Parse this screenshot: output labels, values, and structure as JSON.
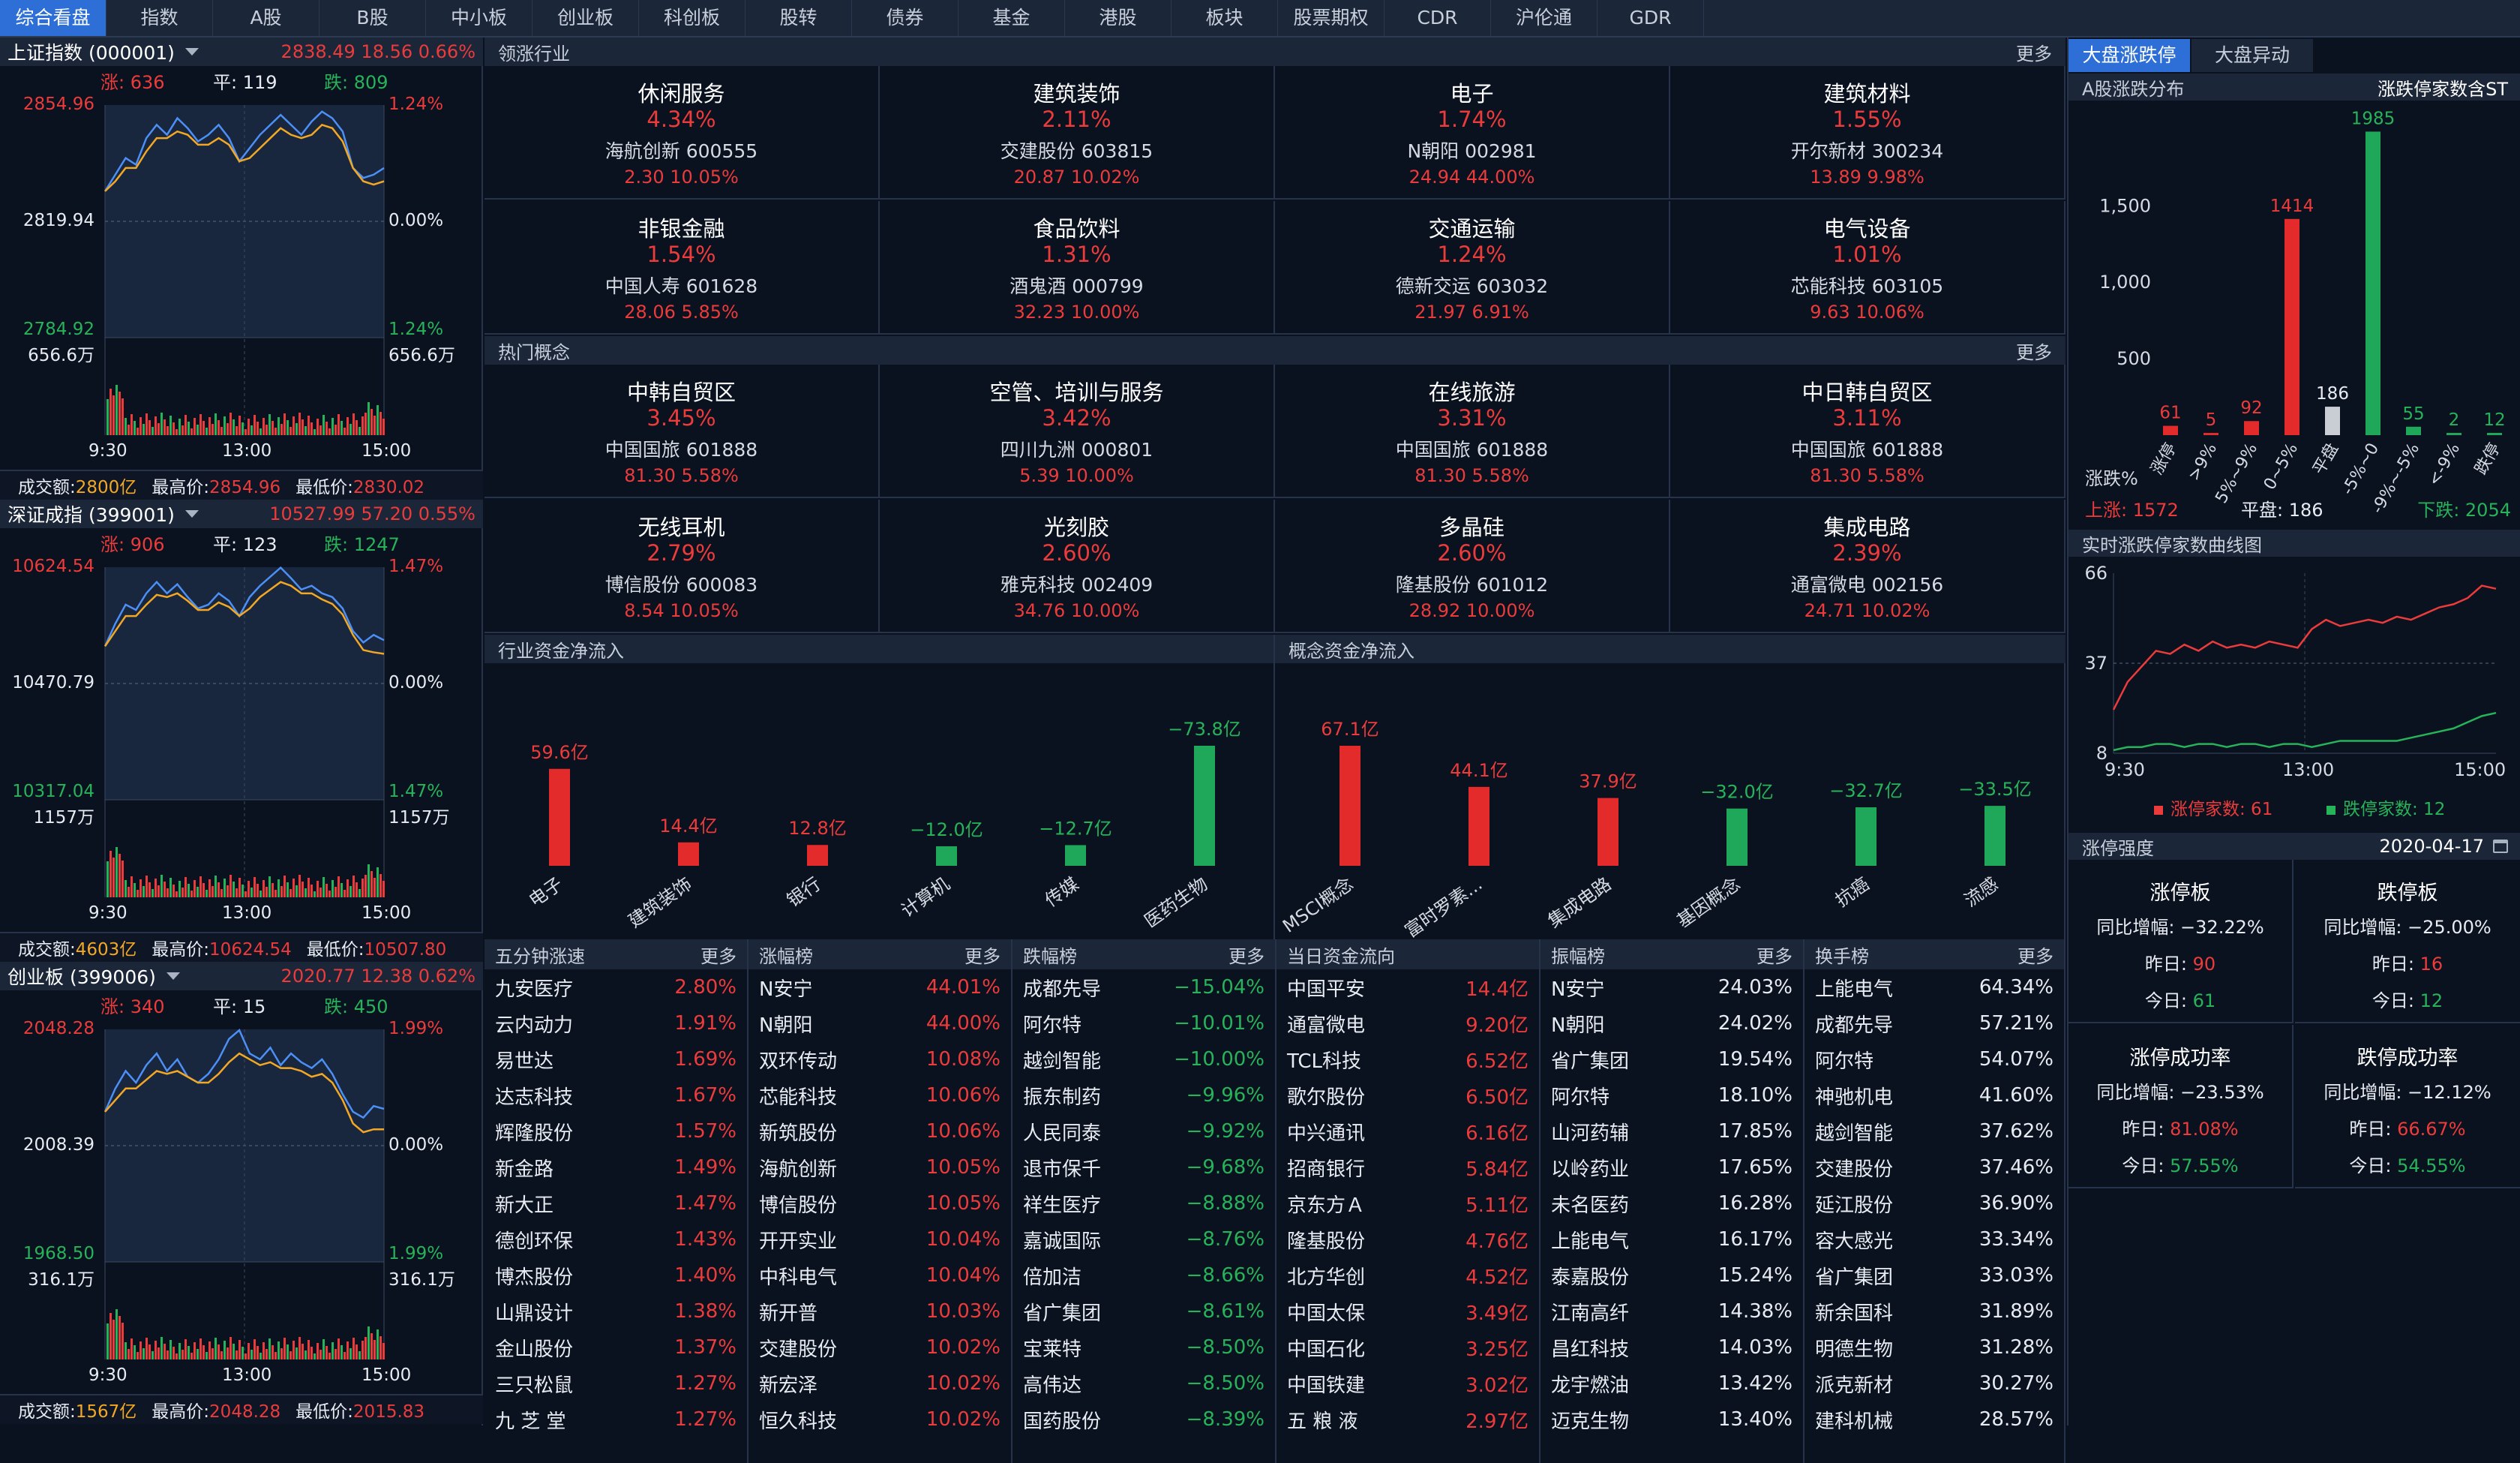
{
  "nav": {
    "tabs": [
      "综合看盘",
      "指数",
      "A股",
      "B股",
      "中小板",
      "创业板",
      "科创板",
      "股转",
      "债券",
      "基金",
      "港股",
      "板块",
      "股票期权",
      "CDR",
      "沪伦通",
      "GDR"
    ],
    "active": 0
  },
  "indices": [
    {
      "name": "上证指数 (000001)",
      "value": "2838.49",
      "change": "18.56",
      "pct": "0.66%",
      "up_label": "涨: 636",
      "flat_label": "平: 119",
      "down_label": "跌: 809",
      "y_top": "2854.96",
      "y_mid": "2819.94",
      "y_bot": "2784.92",
      "p_top": "1.24%",
      "p_mid": "0.00%",
      "p_bot": "1.24%",
      "vol_label": "656.6万",
      "vol_label_r": "656.6万",
      "times": [
        "9:30",
        "13:00",
        "15:00"
      ],
      "turnover_label": "成交额:",
      "turnover": "2800亿",
      "high_label": "最高价:",
      "high": "2854.96",
      "low_label": "最低价:",
      "low": "2830.02",
      "price": [
        2829,
        2834,
        2839,
        2837,
        2845,
        2849,
        2846,
        2851,
        2848,
        2844,
        2846,
        2849,
        2845,
        2838,
        2842,
        2846,
        2849,
        2852,
        2849,
        2846,
        2850,
        2853,
        2851,
        2847,
        2836,
        2833,
        2834,
        2836
      ],
      "avg": [
        2829,
        2832,
        2836,
        2836,
        2841,
        2845,
        2845,
        2847,
        2846,
        2843,
        2843,
        2845,
        2843,
        2838,
        2839,
        2842,
        2845,
        2848,
        2846,
        2845,
        2846,
        2849,
        2848,
        2844,
        2836,
        2832,
        2831,
        2832
      ]
    },
    {
      "name": "深证成指 (399001)",
      "value": "10527.99",
      "change": "57.20",
      "pct": "0.55%",
      "up_label": "涨: 906",
      "flat_label": "平: 123",
      "down_label": "跌: 1247",
      "y_top": "10624.54",
      "y_mid": "10470.79",
      "y_bot": "10317.04",
      "p_top": "1.47%",
      "p_mid": "0.00%",
      "p_bot": "1.47%",
      "vol_label": "1157万",
      "vol_label_r": "1157万",
      "times": [
        "9:30",
        "13:00",
        "15:00"
      ],
      "turnover_label": "成交额:",
      "turnover": "4603亿",
      "high_label": "最高价:",
      "high": "10624.54",
      "low_label": "最低价:",
      "low": "10507.80",
      "price": [
        10520,
        10550,
        10575,
        10568,
        10590,
        10605,
        10590,
        10602,
        10585,
        10570,
        10575,
        10590,
        10580,
        10560,
        10585,
        10600,
        10612,
        10624,
        10610,
        10595,
        10600,
        10590,
        10585,
        10570,
        10540,
        10525,
        10535,
        10528
      ],
      "avg": [
        10520,
        10540,
        10560,
        10560,
        10575,
        10588,
        10585,
        10590,
        10580,
        10568,
        10568,
        10578,
        10572,
        10560,
        10570,
        10585,
        10595,
        10605,
        10600,
        10590,
        10590,
        10582,
        10576,
        10562,
        10535,
        10515,
        10512,
        10510
      ]
    },
    {
      "name": "创业板 (399006)",
      "value": "2020.77",
      "change": "12.38",
      "pct": "0.62%",
      "up_label": "涨: 340",
      "flat_label": "平: 15",
      "down_label": "跌: 450",
      "y_top": "2048.28",
      "y_mid": "2008.39",
      "y_bot": "1968.50",
      "p_top": "1.99%",
      "p_mid": "0.00%",
      "p_bot": "1.99%",
      "vol_label": "316.1万",
      "vol_label_r": "316.1万",
      "times": [
        "9:30",
        "13:00",
        "15:00"
      ],
      "turnover_label": "成交额:",
      "turnover": "1567亿",
      "high_label": "最高价:",
      "high": "2048.28",
      "low_label": "最低价:",
      "low": "2015.83",
      "price": [
        2020,
        2028,
        2034,
        2030,
        2036,
        2040,
        2034,
        2038,
        2032,
        2030,
        2033,
        2038,
        2045,
        2048,
        2040,
        2038,
        2042,
        2036,
        2040,
        2037,
        2035,
        2038,
        2033,
        2026,
        2020,
        2018,
        2022,
        2021
      ],
      "avg": [
        2020,
        2024,
        2028,
        2028,
        2031,
        2034,
        2033,
        2034,
        2032,
        2030,
        2030,
        2033,
        2037,
        2040,
        2038,
        2036,
        2037,
        2035,
        2035,
        2034,
        2032,
        2033,
        2030,
        2024,
        2016,
        2013,
        2014,
        2014
      ]
    }
  ],
  "leading": {
    "title": "领涨行业",
    "more": "更多",
    "cells": [
      {
        "name": "休闲服务",
        "pct": "4.34%",
        "stock": "海航创新 600555",
        "info": "2.30 10.05%"
      },
      {
        "name": "建筑装饰",
        "pct": "2.11%",
        "stock": "交建股份 603815",
        "info": "20.87 10.02%"
      },
      {
        "name": "电子",
        "pct": "1.74%",
        "stock": "N朝阳 002981",
        "info": "24.94 44.00%"
      },
      {
        "name": "建筑材料",
        "pct": "1.55%",
        "stock": "开尔新材 300234",
        "info": "13.89 9.98%"
      },
      {
        "name": "非银金融",
        "pct": "1.54%",
        "stock": "中国人寿 601628",
        "info": "28.06 5.85%"
      },
      {
        "name": "食品饮料",
        "pct": "1.31%",
        "stock": "酒鬼酒 000799",
        "info": "32.23 10.00%"
      },
      {
        "name": "交通运输",
        "pct": "1.24%",
        "stock": "德新交运 603032",
        "info": "21.97 6.91%"
      },
      {
        "name": "电气设备",
        "pct": "1.01%",
        "stock": "芯能科技 603105",
        "info": "9.63 10.06%"
      }
    ]
  },
  "concepts": {
    "title": "热门概念",
    "more": "更多",
    "cells": [
      {
        "name": "中韩自贸区",
        "pct": "3.45%",
        "stock": "中国国旅 601888",
        "info": "81.30 5.58%"
      },
      {
        "name": "空管、培训与服务",
        "pct": "3.42%",
        "stock": "四川九洲 000801",
        "info": "5.39 10.00%"
      },
      {
        "name": "在线旅游",
        "pct": "3.31%",
        "stock": "中国国旅 601888",
        "info": "81.30 5.58%"
      },
      {
        "name": "中日韩自贸区",
        "pct": "3.11%",
        "stock": "中国国旅 601888",
        "info": "81.30 5.58%"
      },
      {
        "name": "无线耳机",
        "pct": "2.79%",
        "stock": "博信股份 600083",
        "info": "8.54 10.05%"
      },
      {
        "name": "光刻胶",
        "pct": "2.60%",
        "stock": "雅克科技 002409",
        "info": "34.76 10.00%"
      },
      {
        "name": "多晶硅",
        "pct": "2.60%",
        "stock": "隆基股份 601012",
        "info": "28.92 10.00%"
      },
      {
        "name": "集成电路",
        "pct": "2.39%",
        "stock": "通富微电 002156",
        "info": "24.71 10.02%"
      }
    ]
  },
  "chart_data": [
    {
      "type": "bar",
      "title": "行业资金净流入",
      "categories": [
        "电子",
        "建筑装饰",
        "银行",
        "计算机",
        "传媒",
        "医药生物"
      ],
      "values": [
        59.6,
        14.4,
        12.8,
        -12.0,
        -12.7,
        -73.8
      ],
      "labels": [
        "59.6亿",
        "14.4亿",
        "12.8亿",
        "−12.0亿",
        "−12.7亿",
        "−73.8亿"
      ]
    },
    {
      "type": "bar",
      "title": "概念资金净流入",
      "categories": [
        "MSCI概念",
        "富时罗素...",
        "集成电路",
        "基因概念",
        "抗癌",
        "流感"
      ],
      "values": [
        67.1,
        44.1,
        37.9,
        -32.0,
        -32.7,
        -33.5
      ],
      "labels": [
        "67.1亿",
        "44.1亿",
        "37.9亿",
        "−32.0亿",
        "−32.7亿",
        "−33.5亿"
      ]
    },
    {
      "type": "bar",
      "title": "A股涨跌分布",
      "right_title": "涨跌停家数含ST",
      "categories": [
        "涨停",
        ">9%",
        "5%~9%",
        "0~5%",
        "平盘",
        "-5%~0",
        "-9%~-5%",
        "<-9%",
        "跌停"
      ],
      "values": [
        61,
        5,
        92,
        1414,
        186,
        1985,
        55,
        2,
        12
      ],
      "ylabel": "涨跌%",
      "yticks": [
        "1,500",
        "1,000",
        "500"
      ],
      "ylim": [
        0,
        2100
      ],
      "footer": {
        "up_label": "上涨:",
        "up": "1572",
        "flat_label": "平盘:",
        "flat": "186",
        "down_label": "下跌:",
        "down": "2054"
      }
    },
    {
      "type": "line",
      "title": "实时涨跌停家数曲线图",
      "yticks": [
        "66",
        "37",
        "8"
      ],
      "ylim": [
        8,
        66
      ],
      "x_ticks": [
        "9:30",
        "13:00",
        "15:00"
      ],
      "series": [
        {
          "name": "涨停家数: 61",
          "color": "#ec3b3b",
          "values": [
            22,
            31,
            36,
            41,
            40,
            43,
            41,
            44,
            42,
            43,
            42,
            44,
            43,
            42,
            48,
            51,
            49,
            50,
            51,
            50,
            52,
            51,
            53,
            55,
            56,
            58,
            62,
            61
          ]
        },
        {
          "name": "跌停家数: 12",
          "color": "#27b35a",
          "values": [
            9,
            10,
            10,
            11,
            11,
            10,
            11,
            11,
            10,
            11,
            11,
            10,
            11,
            11,
            10,
            11,
            12,
            12,
            12,
            12,
            12,
            13,
            14,
            15,
            16,
            18,
            20,
            21
          ]
        }
      ]
    }
  ],
  "lists": [
    {
      "title": "五分钟涨速",
      "more": "更多",
      "rows": [
        [
          "九安医疗",
          "2.80%",
          "red"
        ],
        [
          "云内动力",
          "1.91%",
          "red"
        ],
        [
          "易世达",
          "1.69%",
          "red"
        ],
        [
          "达志科技",
          "1.67%",
          "red"
        ],
        [
          "辉隆股份",
          "1.57%",
          "red"
        ],
        [
          "新金路",
          "1.49%",
          "red"
        ],
        [
          "新大正",
          "1.47%",
          "red"
        ],
        [
          "德创环保",
          "1.43%",
          "red"
        ],
        [
          "博杰股份",
          "1.40%",
          "red"
        ],
        [
          "山鼎设计",
          "1.38%",
          "red"
        ],
        [
          "金山股份",
          "1.37%",
          "red"
        ],
        [
          "三只松鼠",
          "1.27%",
          "red"
        ],
        [
          "九 芝 堂",
          "1.27%",
          "red"
        ]
      ]
    },
    {
      "title": "涨幅榜",
      "more": "更多",
      "rows": [
        [
          "N安宁",
          "44.01%",
          "red"
        ],
        [
          "N朝阳",
          "44.00%",
          "red"
        ],
        [
          "双环传动",
          "10.08%",
          "red"
        ],
        [
          "芯能科技",
          "10.06%",
          "red"
        ],
        [
          "新筑股份",
          "10.06%",
          "red"
        ],
        [
          "海航创新",
          "10.05%",
          "red"
        ],
        [
          "博信股份",
          "10.05%",
          "red"
        ],
        [
          "开开实业",
          "10.04%",
          "red"
        ],
        [
          "中科电气",
          "10.04%",
          "red"
        ],
        [
          "新开普",
          "10.03%",
          "red"
        ],
        [
          "交建股份",
          "10.02%",
          "red"
        ],
        [
          "新宏泽",
          "10.02%",
          "red"
        ],
        [
          "恒久科技",
          "10.02%",
          "red"
        ]
      ]
    },
    {
      "title": "跌幅榜",
      "more": "更多",
      "rows": [
        [
          "成都先导",
          "−15.04%",
          "green"
        ],
        [
          "阿尔特",
          "−10.01%",
          "green"
        ],
        [
          "越剑智能",
          "−10.00%",
          "green"
        ],
        [
          "振东制药",
          "−9.96%",
          "green"
        ],
        [
          "人民同泰",
          "−9.92%",
          "green"
        ],
        [
          "退市保千",
          "−9.68%",
          "green"
        ],
        [
          "祥生医疗",
          "−8.88%",
          "green"
        ],
        [
          "嘉诚国际",
          "−8.76%",
          "green"
        ],
        [
          "倍加洁",
          "−8.66%",
          "green"
        ],
        [
          "省广集团",
          "−8.61%",
          "green"
        ],
        [
          "宝莱特",
          "−8.50%",
          "green"
        ],
        [
          "高伟达",
          "−8.50%",
          "green"
        ],
        [
          "国药股份",
          "−8.39%",
          "green"
        ]
      ]
    },
    {
      "title": "当日资金流向",
      "more": "",
      "rows": [
        [
          "中国平安",
          "14.4亿",
          "red"
        ],
        [
          "通富微电",
          "9.20亿",
          "red"
        ],
        [
          "TCL科技",
          "6.52亿",
          "red"
        ],
        [
          "歌尔股份",
          "6.50亿",
          "red"
        ],
        [
          "中兴通讯",
          "6.16亿",
          "red"
        ],
        [
          "招商银行",
          "5.84亿",
          "red"
        ],
        [
          "京东方Ａ",
          "5.11亿",
          "red"
        ],
        [
          "隆基股份",
          "4.76亿",
          "red"
        ],
        [
          "北方华创",
          "4.52亿",
          "red"
        ],
        [
          "中国太保",
          "3.49亿",
          "red"
        ],
        [
          "中国石化",
          "3.25亿",
          "red"
        ],
        [
          "中国铁建",
          "3.02亿",
          "red"
        ],
        [
          "五 粮 液",
          "2.97亿",
          "red"
        ]
      ]
    },
    {
      "title": "振幅榜",
      "more": "更多",
      "rows": [
        [
          "N安宁",
          "24.03%",
          "white"
        ],
        [
          "N朝阳",
          "24.02%",
          "white"
        ],
        [
          "省广集团",
          "19.54%",
          "white"
        ],
        [
          "阿尔特",
          "18.10%",
          "white"
        ],
        [
          "山河药辅",
          "17.85%",
          "white"
        ],
        [
          "以岭药业",
          "17.65%",
          "white"
        ],
        [
          "未名医药",
          "16.28%",
          "white"
        ],
        [
          "上能电气",
          "16.17%",
          "white"
        ],
        [
          "泰嘉股份",
          "15.24%",
          "white"
        ],
        [
          "江南高纤",
          "14.38%",
          "white"
        ],
        [
          "昌红科技",
          "14.03%",
          "white"
        ],
        [
          "龙宇燃油",
          "13.42%",
          "white"
        ],
        [
          "迈克生物",
          "13.40%",
          "white"
        ]
      ]
    },
    {
      "title": "换手榜",
      "more": "更多",
      "rows": [
        [
          "上能电气",
          "64.34%",
          "white"
        ],
        [
          "成都先导",
          "57.21%",
          "white"
        ],
        [
          "阿尔特",
          "54.07%",
          "white"
        ],
        [
          "神驰机电",
          "41.60%",
          "white"
        ],
        [
          "越剑智能",
          "37.62%",
          "white"
        ],
        [
          "交建股份",
          "37.46%",
          "white"
        ],
        [
          "延江股份",
          "36.90%",
          "white"
        ],
        [
          "容大感光",
          "33.34%",
          "white"
        ],
        [
          "省广集团",
          "33.03%",
          "white"
        ],
        [
          "新余国科",
          "31.89%",
          "white"
        ],
        [
          "明德生物",
          "31.28%",
          "white"
        ],
        [
          "派克新材",
          "30.27%",
          "white"
        ],
        [
          "建科机械",
          "28.57%",
          "white"
        ]
      ]
    }
  ],
  "right": {
    "tabs": [
      "大盘涨跌停",
      "大盘异动"
    ],
    "strength": {
      "title": "涨停强度",
      "date": "2020-04-17",
      "cells": [
        {
          "title": "涨停板",
          "rows": [
            [
              "同比增幅:",
              "−32.22%",
              "white"
            ],
            [
              "昨日:",
              "90",
              "red"
            ],
            [
              "今日:",
              "61",
              "green"
            ]
          ]
        },
        {
          "title": "跌停板",
          "rows": [
            [
              "同比增幅:",
              "−25.00%",
              "white"
            ],
            [
              "昨日:",
              "16",
              "red"
            ],
            [
              "今日:",
              "12",
              "green"
            ]
          ]
        },
        {
          "title": "涨停成功率",
          "rows": [
            [
              "同比增幅:",
              "−23.53%",
              "white"
            ],
            [
              "昨日:",
              "81.08%",
              "red"
            ],
            [
              "今日:",
              "57.55%",
              "green"
            ]
          ]
        },
        {
          "title": "跌停成功率",
          "rows": [
            [
              "同比增幅:",
              "−12.12%",
              "white"
            ],
            [
              "昨日:",
              "66.67%",
              "red"
            ],
            [
              "今日:",
              "54.55%",
              "green"
            ]
          ]
        }
      ]
    }
  }
}
